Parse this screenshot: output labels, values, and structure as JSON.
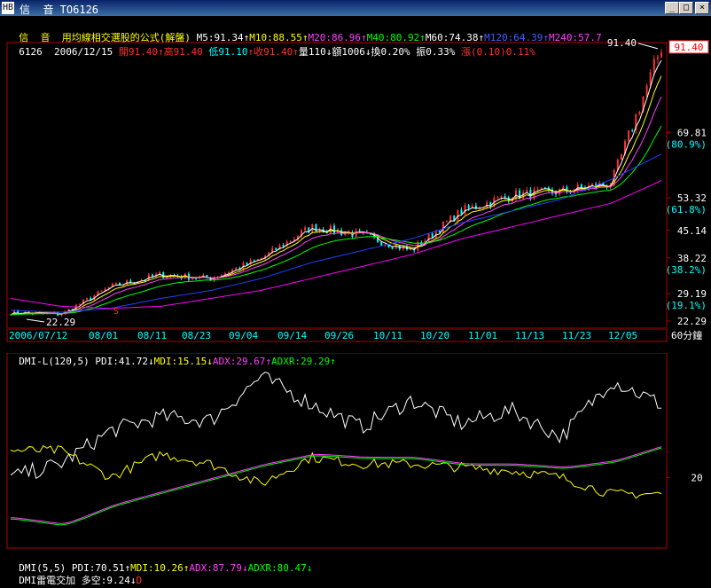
{
  "window": {
    "title": "信  音 TO6126",
    "icon_label": "HB",
    "min_label": "_",
    "max_label": "□",
    "close_label": "×"
  },
  "header": {
    "strategy": "信  音  用均線相交選股的公式(解盤)",
    "ma5": "M5:91.34",
    "ma10": "M10:88.55",
    "ma20": "M20:86.96",
    "ma40": "M40:80.92",
    "ma60": "M60:74.38",
    "ma120": "M120:64.39",
    "ma240": "M240:57.7",
    "code_date": "6126  2006/12/15",
    "open": "開91.40",
    "high": "高91.40",
    "low": "低91.10",
    "close": "收91.40",
    "volume": "量110",
    "amount": "額1006",
    "turnover": "換0.20%",
    "amplitude": "振0.33%",
    "change": "漲(0.10)0.11%",
    "arrow_up": "↑",
    "arrow_down": "↓"
  },
  "price_axis": {
    "labels": [
      {
        "text": "69.81",
        "pct": "(80.9%)"
      },
      {
        "text": "53.32",
        "pct": "(61.8%)"
      },
      {
        "text": "45.14",
        "pct": ""
      },
      {
        "text": "38.22",
        "pct": "(38.2%)"
      },
      {
        "text": "29.19",
        "pct": "(19.1%)"
      },
      {
        "text": "22.29",
        "pct": ""
      }
    ],
    "current": "91.40",
    "high_label": "91.40",
    "low_label": "22.29",
    "marker": "S"
  },
  "date_axis": {
    "labels": [
      "2006/07/12",
      "08/01",
      "08/11",
      "08/23",
      "09/04",
      "09/14",
      "09/26",
      "10/11",
      "10/20",
      "11/01",
      "11/13",
      "11/23",
      "12/05"
    ],
    "period": "60分鐘"
  },
  "dmi_header": {
    "name": "DMI-L(120,5)",
    "pdi": "PDI:41.72",
    "mdi": "MDI:15.15",
    "adx": "ADX:29.67",
    "adxr": "ADXR:29.29",
    "level": "20"
  },
  "footer": {
    "line1_name": "DMI(5,5)",
    "pdi": "PDI:70.51",
    "mdi": "MDI:10.26",
    "adx": "ADX:87.79",
    "adxr": "ADXR:80.47",
    "line2_name": "DMI雷電交加",
    "signal": "多空:9.24",
    "flag": "D"
  },
  "colors": {
    "ma5": "#ffffff",
    "ma10": "#ffff00",
    "ma20": "#ff40ff",
    "ma40": "#00ff00",
    "ma60": "#ffffff",
    "ma120": "#2040ff",
    "ma240": "#ff00ff",
    "up": "#ff3030",
    "down": "#00ffff",
    "grid": "#b00000",
    "pdi": "#ffffff",
    "mdi": "#ffff00",
    "adx": "#ff40ff",
    "adxr": "#00ff00"
  },
  "chart_data": [
    {
      "type": "line",
      "title": "TO6126 60分鐘",
      "x": [
        "2006/07/12",
        "08/01",
        "08/11",
        "08/23",
        "09/04",
        "09/14",
        "09/26",
        "10/11",
        "10/20",
        "11/01",
        "11/13",
        "11/23",
        "12/05",
        "12/15"
      ],
      "series": [
        {
          "name": "Close",
          "values": [
            24.5,
            24,
            31,
            34,
            33,
            38,
            46,
            44,
            40,
            50,
            54,
            55,
            57,
            91.4
          ]
        },
        {
          "name": "M120",
          "values": [
            25,
            24.5,
            25.5,
            28,
            30,
            33,
            37,
            40,
            43,
            47,
            50,
            53,
            58,
            64.39
          ]
        },
        {
          "name": "M240",
          "values": [
            28,
            26,
            25.5,
            26,
            28,
            30,
            33,
            36,
            39,
            43,
            46,
            49,
            52,
            57.7
          ]
        }
      ],
      "ylim": [
        22.29,
        91.4
      ]
    },
    {
      "type": "line",
      "title": "DMI-L(120,5)",
      "x": [
        "2006/07/12",
        "08/01",
        "08/11",
        "08/23",
        "09/04",
        "09/14",
        "09/26",
        "10/11",
        "10/20",
        "11/01",
        "11/13",
        "11/23",
        "12/05",
        "12/15"
      ],
      "series": [
        {
          "name": "PDI",
          "values": [
            20,
            24,
            34,
            38,
            37,
            50,
            42,
            35,
            43,
            36,
            40,
            32,
            49,
            41.72
          ]
        },
        {
          "name": "MDI",
          "values": [
            28,
            28,
            20,
            27,
            24,
            18,
            26,
            24,
            24,
            23,
            22,
            20,
            15,
            15.15
          ]
        },
        {
          "name": "ADX",
          "values": [
            8,
            6,
            12,
            16,
            20,
            24,
            27,
            26,
            26,
            24,
            24,
            23,
            25,
            29.67
          ]
        },
        {
          "name": "ADXR",
          "values": [
            8,
            6,
            12,
            16,
            20,
            24,
            27,
            26,
            26,
            24,
            24,
            23,
            25,
            29.29
          ]
        }
      ],
      "reference_level": 20
    }
  ]
}
